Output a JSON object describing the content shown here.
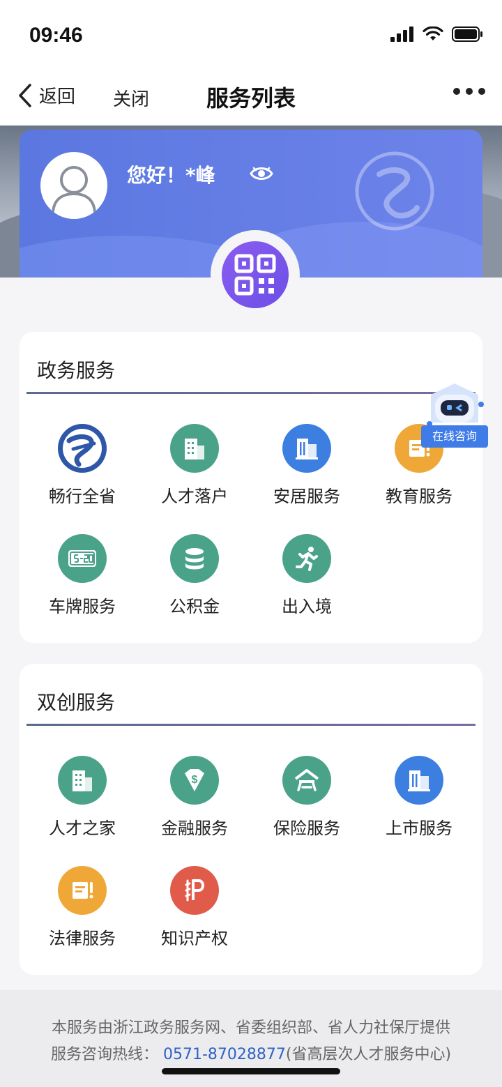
{
  "status_bar": {
    "time": "09:46"
  },
  "nav": {
    "back_label": "返回",
    "close_label": "关闭",
    "title": "服务列表"
  },
  "profile": {
    "greeting": "您好！*峰"
  },
  "sections": [
    {
      "title": "政务服务",
      "items": [
        {
          "label": "畅行全省",
          "icon": "zhejiang-logo-icon",
          "color": "#2e57a8"
        },
        {
          "label": "人才落户",
          "icon": "building-icon",
          "color": "#4aa389"
        },
        {
          "label": "安居服务",
          "icon": "apartment-icon",
          "color": "#3d7fe0"
        },
        {
          "label": "教育服务",
          "icon": "education-icon",
          "color": "#efa838"
        },
        {
          "label": "车牌服务",
          "icon": "license-plate-icon",
          "color": "#4aa389"
        },
        {
          "label": "公积金",
          "icon": "coins-icon",
          "color": "#4aa389"
        },
        {
          "label": "出入境",
          "icon": "running-person-icon",
          "color": "#4aa389"
        }
      ]
    },
    {
      "title": "双创服务",
      "items": [
        {
          "label": "人才之家",
          "icon": "building-icon",
          "color": "#4aa389"
        },
        {
          "label": "金融服务",
          "icon": "dollar-diamond-icon",
          "color": "#4aa389"
        },
        {
          "label": "保险服务",
          "icon": "shelter-icon",
          "color": "#4aa389"
        },
        {
          "label": "上市服务",
          "icon": "apartment-icon",
          "color": "#3d7fe0"
        },
        {
          "label": "法律服务",
          "icon": "legal-notice-icon",
          "color": "#efa838"
        },
        {
          "label": "知识产权",
          "icon": "ip-icon",
          "color": "#e15b4a"
        }
      ]
    }
  ],
  "bot": {
    "label": "在线咨询"
  },
  "footer": {
    "line1": "本服务由浙江政务服务网、省委组织部、省人力社保厅提供",
    "hotline_prefix": "服务咨询热线：",
    "hotline_number": "0571-87028877",
    "hotline_suffix": "(省高层次人才服务中心)"
  }
}
